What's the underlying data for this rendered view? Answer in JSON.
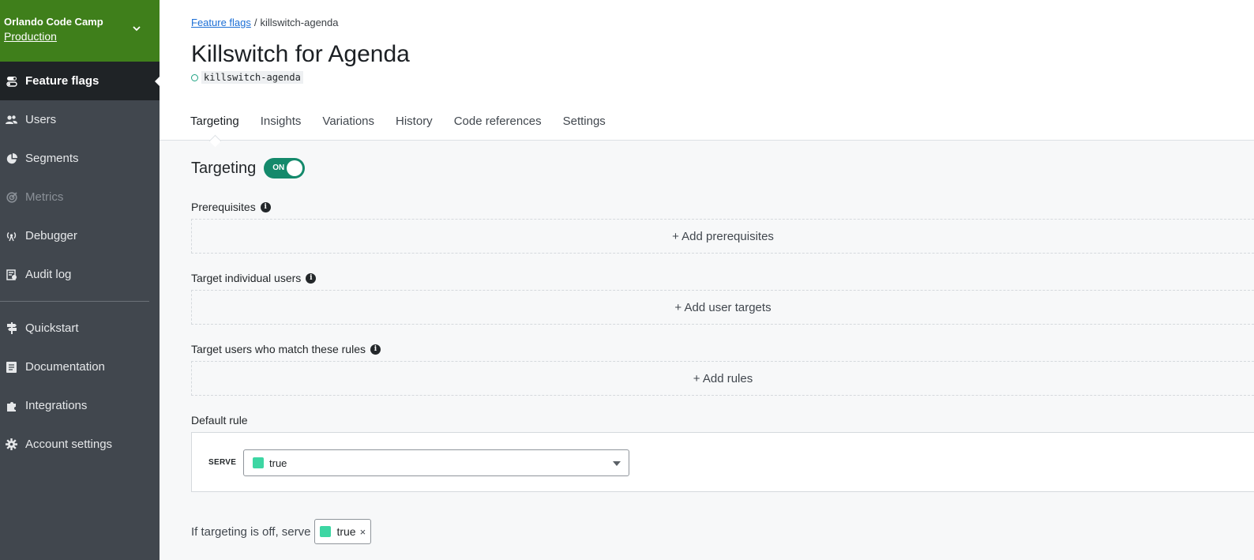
{
  "sidebar": {
    "project_name": "Orlando Code Camp",
    "environment": "Production",
    "items": [
      {
        "label": "Feature flags",
        "icon": "toggle-icon",
        "active": true
      },
      {
        "label": "Users",
        "icon": "users-icon"
      },
      {
        "label": "Segments",
        "icon": "pie-icon"
      },
      {
        "label": "Metrics",
        "icon": "target-icon",
        "disabled": true
      },
      {
        "label": "Debugger",
        "icon": "broadcast-icon"
      },
      {
        "label": "Audit log",
        "icon": "audit-icon"
      }
    ],
    "secondary_items": [
      {
        "label": "Quickstart",
        "icon": "signpost-icon"
      },
      {
        "label": "Documentation",
        "icon": "book-icon"
      },
      {
        "label": "Integrations",
        "icon": "puzzle-icon"
      },
      {
        "label": "Account settings",
        "icon": "gear-icon"
      }
    ]
  },
  "breadcrumb": {
    "parent": "Feature flags",
    "separator": "/",
    "current": "killswitch-agenda"
  },
  "flag": {
    "title": "Killswitch for Agenda",
    "key": "killswitch-agenda"
  },
  "tabs": [
    "Targeting",
    "Insights",
    "Variations",
    "History",
    "Code references",
    "Settings"
  ],
  "targeting": {
    "label": "Targeting",
    "toggle_state": "ON"
  },
  "sections": {
    "prerequisites": {
      "label": "Prerequisites",
      "action": "+ Add prerequisites"
    },
    "individual": {
      "label": "Target individual users",
      "action": "+ Add user targets"
    },
    "rules": {
      "label": "Target users who match these rules",
      "action": "+ Add rules"
    }
  },
  "default_rule": {
    "label": "Default rule",
    "serve_label": "SERVE",
    "selected_variation": "true"
  },
  "off_variation": {
    "label": "If targeting is off, serve",
    "value": "true",
    "remove_glyph": "×"
  },
  "colors": {
    "project_header": "#3f7f1b",
    "sidebar": "#41474e",
    "toggle_on": "#14896b",
    "variation_true": "#3dd6a3",
    "link": "#1c6fd6"
  }
}
